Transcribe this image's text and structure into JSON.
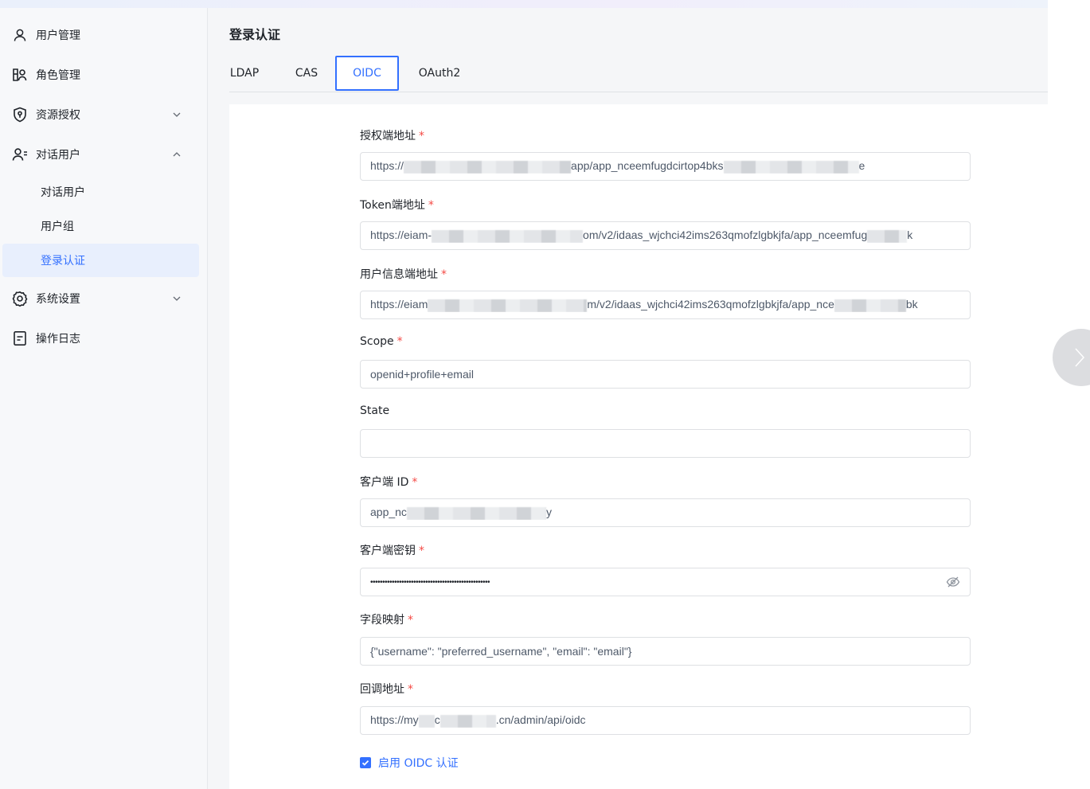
{
  "sidebar": {
    "items": [
      {
        "label": "用户管理",
        "icon": "user-icon"
      },
      {
        "label": "角色管理",
        "icon": "role-icon"
      },
      {
        "label": "资源授权",
        "icon": "shield-icon",
        "expanded": false
      },
      {
        "label": "对话用户",
        "icon": "user-group-icon",
        "expanded": true
      },
      {
        "label": "系统设置",
        "icon": "gear-icon",
        "expanded": false
      },
      {
        "label": "操作日志",
        "icon": "log-icon"
      }
    ],
    "subitems": [
      {
        "label": "对话用户"
      },
      {
        "label": "用户组"
      },
      {
        "label": "登录认证",
        "active": true
      }
    ]
  },
  "page": {
    "title": "登录认证"
  },
  "tabs": [
    {
      "label": "LDAP"
    },
    {
      "label": "CAS"
    },
    {
      "label": "OIDC",
      "active": true
    },
    {
      "label": "OAuth2"
    }
  ],
  "form": {
    "auth_url": {
      "label": "授权端地址",
      "value_start": "https://",
      "value_mid": "app/app_nceemfugdcirtop4bks",
      "value_end": "e"
    },
    "token_url": {
      "label": "Token端地址",
      "value_start": "https://eiam-",
      "value_mid": "om/v2/idaas_wjchci42ims263qmofzlgbkjfa/app_nceemfug",
      "value_end": "k"
    },
    "userinfo_url": {
      "label": "用户信息端地址",
      "value_start": "https://eiam",
      "value_mid": "m/v2/idaas_wjchci42ims263qmofzlgbkjfa/app_nce",
      "value_end": "bk"
    },
    "scope": {
      "label": "Scope",
      "value": "openid+profile+email"
    },
    "state": {
      "label": "State",
      "value": ""
    },
    "client_id": {
      "label": "客户端 ID",
      "value_start": "app_nc",
      "value_end": "y"
    },
    "client_secret": {
      "label": "客户端密钥",
      "value": "••••••••••••••••••••••••••••••••••••••••••••••••••"
    },
    "field_mapping": {
      "label": "字段映射",
      "value": "{\"username\": \"preferred_username\", \"email\": \"email\"}"
    },
    "callback_url": {
      "label": "回调地址",
      "value_start": "https://my",
      "value_mid": "c",
      "value_end": ".cn/admin/api/oidc"
    },
    "enable_label": "启用 OIDC 认证",
    "enable_checked": true
  },
  "colors": {
    "accent": "#3370ff",
    "required": "#f54a45",
    "active_bg": "#e8effd"
  }
}
